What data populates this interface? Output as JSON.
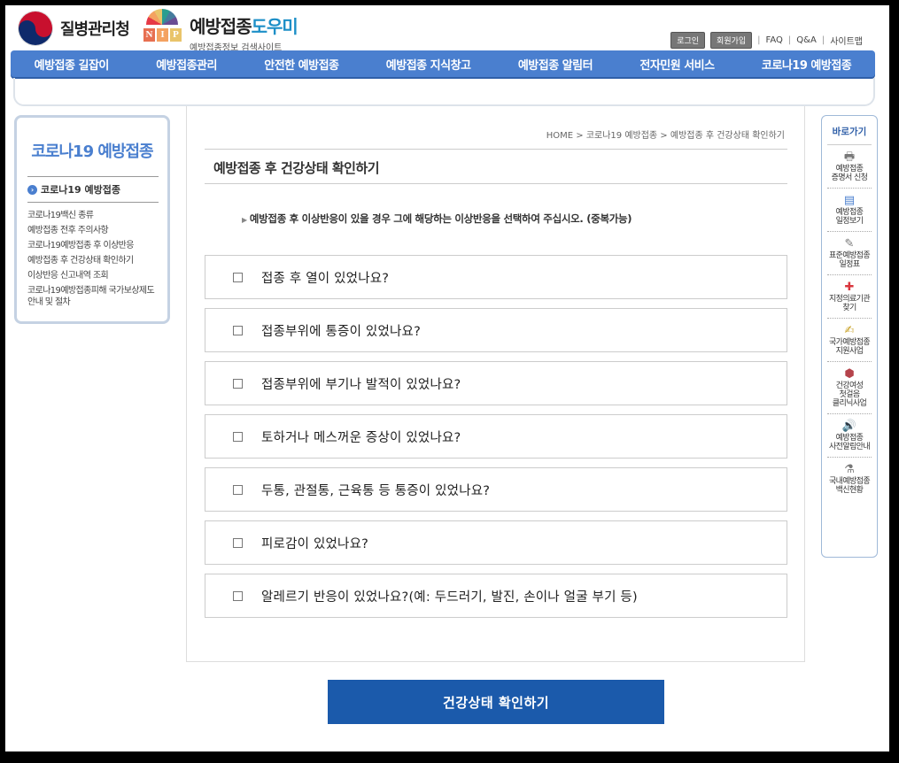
{
  "header": {
    "kdca_name": "질병관리청",
    "nip_letters": [
      "N",
      "I",
      "P"
    ],
    "nip_title_main": "예방접종",
    "nip_title_accent": "도우미",
    "nip_subtitle": "예방접종정보 검색사이트",
    "util": {
      "login": "로그인",
      "join": "회원가입",
      "faq": "FAQ",
      "qa": "Q&A",
      "sitemap": "사이트맵"
    }
  },
  "nav": [
    "예방접종 길잡이",
    "예방접종관리",
    "안전한 예방접종",
    "예방접종 지식창고",
    "예방접종 알림터",
    "전자민원 서비스",
    "코로나19 예방접종"
  ],
  "sidebar": {
    "title": "코로나19 예방접종",
    "section": "코로나19 예방접종",
    "items": [
      "코로나19백신 종류",
      "예방접종 전후 주의사항",
      "코로나19예방접종 후 이상반응",
      "예방접종 후 건강상태 확인하기",
      "이상반응 신고내역 조회",
      "코로나19예방접종피해 국가보상제도 안내 및 절차"
    ]
  },
  "main": {
    "breadcrumb": "HOME > 코로나19 예방접종 > 예방접종 후 건강상태 확인하기",
    "title": "예방접종 후 건강상태 확인하기",
    "instruction": "예방접종 후 이상반응이 있을 경우 그에 해당하는 이상반응을 선택하여 주십시오. (중복가능)",
    "questions": [
      "접종 후 열이 있었나요?",
      "접종부위에 통증이 있었나요?",
      "접종부위에 부기나 발적이 있었나요?",
      "토하거나 메스꺼운 증상이 있었나요?",
      "두통, 관절통, 근육통 등 통증이 있었나요?",
      "피로감이 있었나요?",
      "알레르기 반응이 있었나요?(예: 두드러기, 발진, 손이나 얼굴 부기 등)"
    ],
    "submit": "건강상태 확인하기"
  },
  "quickbar": {
    "title": "바로가기",
    "items": [
      {
        "label": "예방접종\n증명서 신청",
        "icon": "printer-icon"
      },
      {
        "label": "예방접종\n일정보기",
        "icon": "calendar-icon"
      },
      {
        "label": "표준예방접종\n일정표",
        "icon": "syringe-icon"
      },
      {
        "label": "지정의료기관\n찾기",
        "icon": "hospital-icon"
      },
      {
        "label": "국가예방접종\n지원사업",
        "icon": "document-icon"
      },
      {
        "label": "건강여성\n첫걸음\n클리닉사업",
        "icon": "box-icon"
      },
      {
        "label": "예방접종\n사전알림안내",
        "icon": "speaker-icon"
      },
      {
        "label": "국내예방접종\n백신현황",
        "icon": "vaccine-icon"
      }
    ]
  },
  "colors": {
    "nav_bg": "#4a7fcf",
    "submit_bg": "#1b5aab",
    "accent": "#1d8fc7"
  }
}
